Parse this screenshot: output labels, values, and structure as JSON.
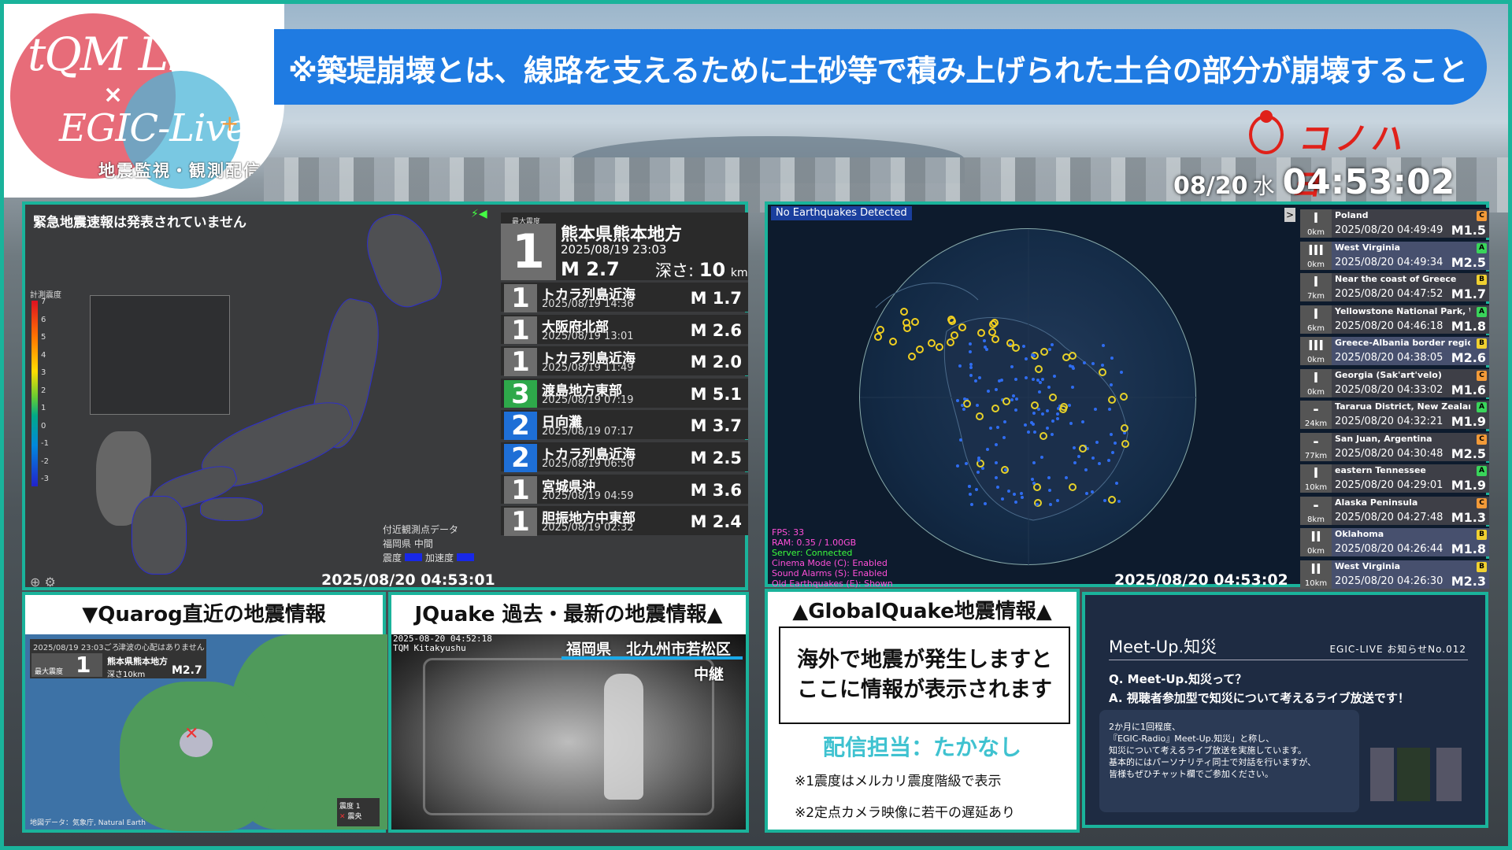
{
  "logo": {
    "line1": "tQM Live",
    "line2": "×",
    "line3": "EGIC-Live",
    "plus": "+",
    "line4": "地震監視・観測配信"
  },
  "ticker": {
    "text": "※築堤崩壊とは、線路を支えるために土砂等で積み上げられた土台の部分が崩壊すること　情報：J"
  },
  "brand": {
    "text": "コノハヨ"
  },
  "clock": {
    "date": "08/20",
    "weekday": "水",
    "time": "04:53:02"
  },
  "jp_panel": {
    "eew": "緊急地震速報は発表されていません",
    "scale_title": "計測震度",
    "scale_labels": [
      "7",
      "6",
      "5",
      "4",
      "3",
      "2",
      "1",
      "0",
      "-1",
      "-2",
      "-3"
    ],
    "station_title": "付近観測点データ",
    "station_name": "福岡県 中間",
    "station_legend1": "震度",
    "station_legend2": "加速度",
    "time": "2025/08/20 04:53:01",
    "top": {
      "label": "最大震度",
      "intensity": "1",
      "place": "熊本県熊本地方",
      "datetime": "2025/08/19 23:03",
      "mag": "M 2.7",
      "depth_label": "深さ:",
      "depth": "10",
      "depth_unit": "km"
    },
    "list": [
      {
        "intensity": "1",
        "place": "トカラ列島近海",
        "datetime": "2025/08/19 14:36",
        "mag": "M 1.7",
        "color": "#6e6e6e"
      },
      {
        "intensity": "1",
        "place": "大阪府北部",
        "datetime": "2025/08/19 13:01",
        "mag": "M 2.6",
        "color": "#6e6e6e"
      },
      {
        "intensity": "1",
        "place": "トカラ列島近海",
        "datetime": "2025/08/19 11:49",
        "mag": "M 2.0",
        "color": "#6e6e6e"
      },
      {
        "intensity": "3",
        "place": "渡島地方東部",
        "datetime": "2025/08/19 07:19",
        "mag": "M 5.1",
        "color": "#2ea84a"
      },
      {
        "intensity": "2",
        "place": "日向灘",
        "datetime": "2025/08/19 07:17",
        "mag": "M 3.7",
        "color": "#1e6fd6"
      },
      {
        "intensity": "2",
        "place": "トカラ列島近海",
        "datetime": "2025/08/19 06:50",
        "mag": "M 2.5",
        "color": "#1e6fd6"
      },
      {
        "intensity": "1",
        "place": "宮城県沖",
        "datetime": "2025/08/19 04:59",
        "mag": "M 3.6",
        "color": "#6e6e6e"
      },
      {
        "intensity": "1",
        "place": "胆振地方中東部",
        "datetime": "2025/08/19 02:32",
        "mag": "M 2.4",
        "color": "#6e6e6e"
      }
    ]
  },
  "gq_panel": {
    "status": "No Earthquakes Detected",
    "stats": [
      {
        "text": "FPS: 33",
        "color": "#ff4fd8"
      },
      {
        "text": "RAM: 0.35 / 1.00GB",
        "color": "#ff4fd8"
      },
      {
        "text": "Server: Connected",
        "color": "#3cff3c"
      },
      {
        "text": "Cinema Mode (C): Enabled",
        "color": "#ff4fd8"
      },
      {
        "text": "Sound Alarms (S): Enabled",
        "color": "#ff4fd8"
      },
      {
        "text": "Old Earthquakes (E): Shown",
        "color": "#ff4fd8"
      }
    ],
    "time": "2025/08/20 04:53:02",
    "arrow": ">",
    "list": [
      {
        "place": "Poland",
        "datetime": "2025/08/20 04:49:49",
        "mag": "M1.5",
        "int": "I",
        "depth": "0km",
        "cls": "C",
        "bg": "#3e3f47",
        "ccol": "#f39a38"
      },
      {
        "place": "West Virginia",
        "datetime": "2025/08/20 04:49:34",
        "mag": "M2.5",
        "int": "III",
        "depth": "0km",
        "cls": "A",
        "bg": "#47506e",
        "ccol": "#39d45a"
      },
      {
        "place": "Near the coast of Greece",
        "datetime": "2025/08/20 04:47:52",
        "mag": "M1.7",
        "int": "I",
        "depth": "7km",
        "cls": "B",
        "bg": "#3e3f47",
        "ccol": "#f0d030"
      },
      {
        "place": "Yellowstone National Park, Wyoming",
        "datetime": "2025/08/20 04:46:18",
        "mag": "M1.8",
        "int": "I",
        "depth": "6km",
        "cls": "A",
        "bg": "#3e3f47",
        "ccol": "#39d45a"
      },
      {
        "place": "Greece-Albania border region",
        "datetime": "2025/08/20 04:38:05",
        "mag": "M2.6",
        "int": "III",
        "depth": "0km",
        "cls": "B",
        "bg": "#47506e",
        "ccol": "#f0d030"
      },
      {
        "place": "Georgia (Sak'art'velo)",
        "datetime": "2025/08/20 04:33:02",
        "mag": "M1.6",
        "int": "I",
        "depth": "0km",
        "cls": "C",
        "bg": "#3e3f47",
        "ccol": "#f39a38"
      },
      {
        "place": "Tararua District, New Zealand",
        "datetime": "2025/08/20 04:32:21",
        "mag": "M1.9",
        "int": "-",
        "depth": "24km",
        "cls": "A",
        "bg": "#3e3f47",
        "ccol": "#39d45a"
      },
      {
        "place": "San Juan, Argentina",
        "datetime": "2025/08/20 04:30:48",
        "mag": "M2.5",
        "int": "-",
        "depth": "77km",
        "cls": "C",
        "bg": "#3e3f47",
        "ccol": "#f39a38"
      },
      {
        "place": "eastern Tennessee",
        "datetime": "2025/08/20 04:29:01",
        "mag": "M1.9",
        "int": "I",
        "depth": "10km",
        "cls": "A",
        "bg": "#3e3f47",
        "ccol": "#39d45a"
      },
      {
        "place": "Alaska Peninsula",
        "datetime": "2025/08/20 04:27:48",
        "mag": "M1.3",
        "int": "-",
        "depth": "8km",
        "cls": "C",
        "bg": "#3e3f47",
        "ccol": "#f39a38"
      },
      {
        "place": "Oklahoma",
        "datetime": "2025/08/20 04:26:44",
        "mag": "M1.8",
        "int": "II",
        "depth": "0km",
        "cls": "B",
        "bg": "#47506e",
        "ccol": "#f0d030"
      },
      {
        "place": "West Virginia",
        "datetime": "2025/08/20 04:26:30",
        "mag": "M2.3",
        "int": "II",
        "depth": "10km",
        "cls": "B",
        "bg": "#47506e",
        "ccol": "#f0d030"
      }
    ]
  },
  "quarog": {
    "header": "▼Quarog直近の地震情報",
    "card_datetime": "2025/08/19 23:03ごろ",
    "card_tsunami": "津波の心配はありません",
    "card_label": "最大震度",
    "card_intensity": "1",
    "card_place": "熊本県熊本地方",
    "card_depth": "深さ10km",
    "card_mag": "M2.7",
    "legend1": "震度 1",
    "legend2": "震央",
    "attribution": "地図データ：気象庁, Natural Earth"
  },
  "jquake": {
    "header": "JQuake 過去・最新の地震情報▲",
    "timestamp": "2025-08-20 04:52:18",
    "cam_name": "TQM Kitakyushu",
    "location": "福岡県　北九州市若松区",
    "relay": "中継"
  },
  "gq_info": {
    "header": "▲GlobalQuake地震情報▲",
    "msg1": "海外で地震が発生しますと",
    "msg2": "ここに情報が表示されます",
    "host": "配信担当：たかなし",
    "note1": "※1震度はメルカリ震度階級で表示",
    "note2": "※2定点カメラ映像に若干の遅延あり"
  },
  "meetup": {
    "title": "Meet-Up.知災",
    "notice": "EGIC-LIVE お知らせNo.012",
    "q": "Q. Meet-Up.知災って？",
    "a": "A. 視聴者参加型で知災について考えるライブ放送です！",
    "body": [
      "2か月に1回程度、",
      "『EGIC-Radio』Meet-Up.知災」と称し、",
      "知災について考えるライブ放送を実施しています。",
      "基本的にはパーソナリティ同士で対話を行いますが、",
      "皆様もぜひチャット欄でご参加ください。"
    ]
  }
}
